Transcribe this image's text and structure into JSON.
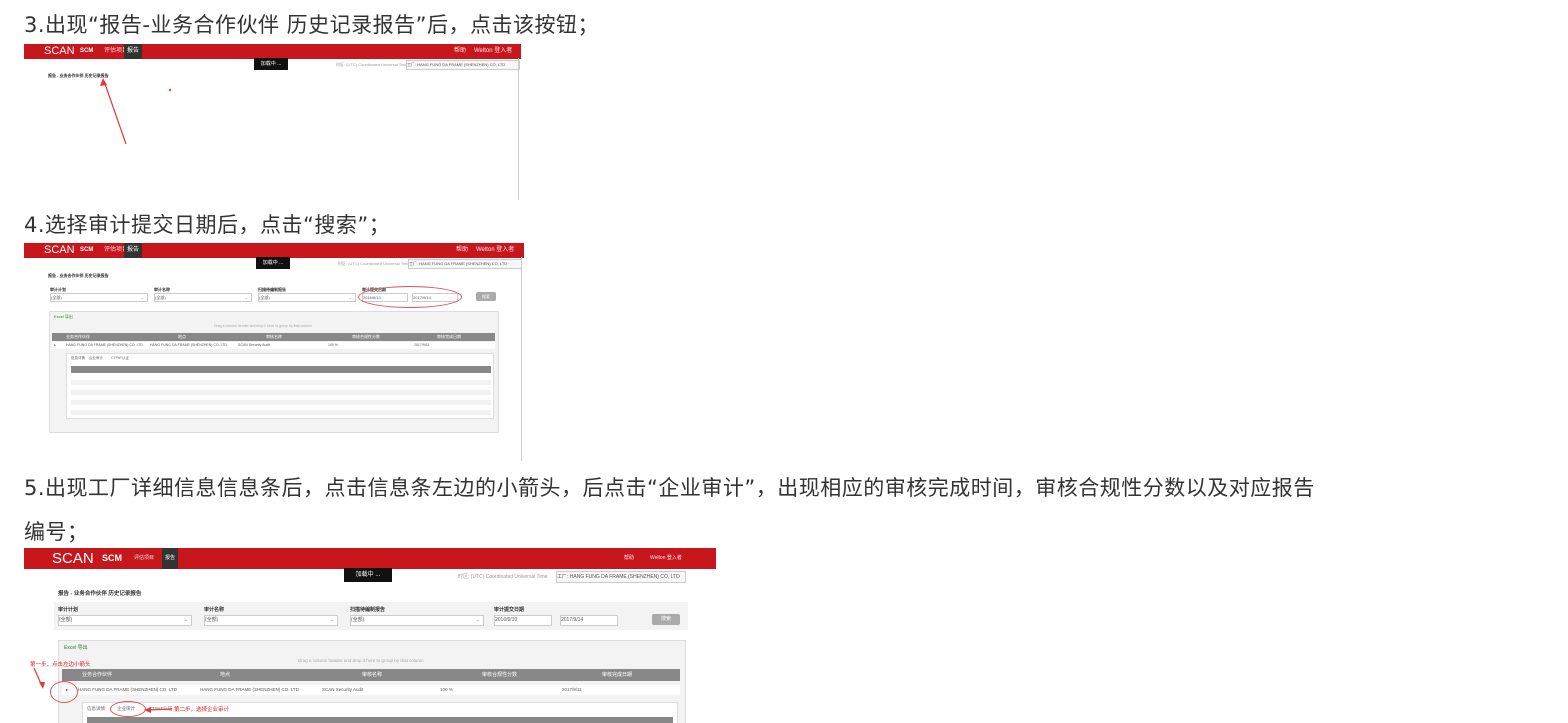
{
  "steps": [
    {
      "text": "3.出现“报告-业务合作伙伴 历史记录报告”后，点击该按钮；"
    },
    {
      "text": "4.选择审计提交日期后，点击“搜索”；"
    },
    {
      "text": "5.出现工厂详细信息信息条后，点击信息条左边的小箭头，后点击“企业审计”，出现相应的审核完成时间，审核合规性分数以及对应报告"
    },
    {
      "text": "编号；"
    }
  ],
  "app": {
    "logo": "SCAN",
    "scm": "SCM",
    "nav_1": "评估项目",
    "nav_2": "报告",
    "help": "帮助",
    "user": "Welton 登入者",
    "loading": "加载中 ...",
    "utc": "时区: (UTC) Coordinated Universal Time",
    "supplier_label": "工厂:",
    "supplier": "HANG FUNG DA FRAME (SHENZHEN) CO, LTD",
    "report_title": "报告 - 业务合作伙伴 历史记录报告"
  },
  "filters": {
    "audit_program": "审计计划",
    "audit_name": "审计名称",
    "scan_report": "扫描待编制报告",
    "submit_date": "审计提交日期",
    "all": "(全部)",
    "date_from": "2016/6/10",
    "date_to": "2017/9/14",
    "search": "搜索"
  },
  "grid": {
    "excel": "Excel 导出",
    "drag_hint": "Drag a column header and drop it here to group by that column",
    "headers": [
      "业务合作伙伴",
      "地点",
      "审核名称",
      "审核合规性分数",
      "审核完成日期"
    ],
    "row": [
      "HANG FUNG DA FRAME (SHENZHEN) CO. LTD",
      "HANG FUNG DA FRAME (SHENZHEN) CO. LTD",
      "SCAN Security Audit",
      "100 %",
      "2017/9/11"
    ],
    "subtabs": [
      "信息详情",
      "企业审计",
      "CTPAT认证"
    ]
  },
  "annotations": {
    "first_step": "第一步，点击左边小箭头",
    "second_step": "第二步，选择企业审计"
  }
}
